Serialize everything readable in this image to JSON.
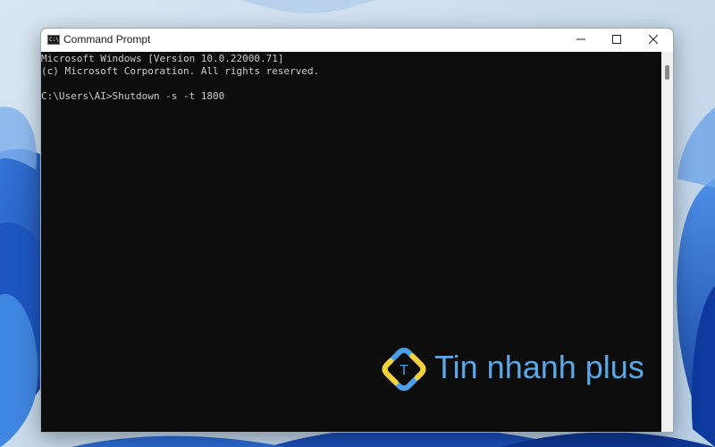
{
  "window": {
    "title": "Command Prompt",
    "app_icon_label": "C:\\_",
    "controls": {
      "minimize_icon": "minimize-icon",
      "maximize_icon": "maximize-icon",
      "close_icon": "close-icon"
    }
  },
  "console": {
    "lines": [
      "Microsoft Windows [Version 10.0.22000.71]",
      "(c) Microsoft Corporation. All rights reserved.",
      "C:\\Users\\AI>Shutdown -s -t 1800"
    ],
    "background_color": "#0c0c0c",
    "text_color": "#cccccc"
  },
  "watermark": {
    "brand": "Tin nhanh plus",
    "logo_letter": "T",
    "colors": {
      "blue": "#4a9fe6",
      "yellow": "#f5d33a"
    }
  },
  "desktop": {
    "wallpaper": "windows-11-bloom"
  }
}
